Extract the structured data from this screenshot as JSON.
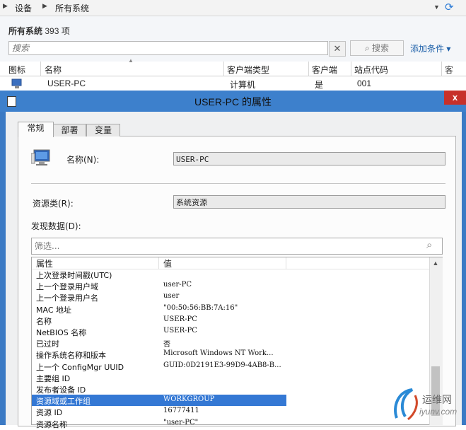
{
  "breadcrumb": {
    "items": [
      "设备",
      "所有系统"
    ]
  },
  "list_header": {
    "title": "所有系统",
    "count": "393",
    "unit": "项"
  },
  "search": {
    "placeholder": "搜索",
    "clear": "✕",
    "button": "搜索",
    "add_criteria": "添加条件 ▾"
  },
  "grid": {
    "columns": [
      "图标",
      "名称",
      "客户端类型",
      "客户端",
      "站点代码"
    ],
    "rows": [
      {
        "name": "USER-PC",
        "client_type": "计算机",
        "client": "是",
        "site_code": "001"
      }
    ]
  },
  "dialog": {
    "title": "USER-PC 的属性",
    "close": "x",
    "tabs": [
      "常规",
      "部署",
      "变量"
    ],
    "name_label": "名称(N):",
    "name_value": "USER-PC",
    "resource_class_label": "资源类(R):",
    "resource_class_value": "系统资源",
    "discovery_label": "发现数据(D):",
    "filter_placeholder": "筛选...",
    "columns": [
      "属性",
      "值"
    ],
    "properties": [
      {
        "name": "上次登录时间戳(UTC)",
        "value": ""
      },
      {
        "name": "上一个登录用户域",
        "value": "user-PC"
      },
      {
        "name": "上一个登录用户名",
        "value": "user"
      },
      {
        "name": "MAC 地址",
        "value": "\"00:50:56:BB:7A:16\""
      },
      {
        "name": "名称",
        "value": "USER-PC"
      },
      {
        "name": "NetBIOS 名称",
        "value": "USER-PC"
      },
      {
        "name": "已过时",
        "value": "否"
      },
      {
        "name": "操作系统名称和版本",
        "value": "Microsoft Windows NT Work..."
      },
      {
        "name": "上一个 ConfigMgr UUID",
        "value": "GUID:0D2191E3-99D9-4AB8-B..."
      },
      {
        "name": "主要组 ID",
        "value": ""
      },
      {
        "name": "发布者设备 ID",
        "value": ""
      },
      {
        "name": "资源域或工作组",
        "value": "WORKGROUP"
      },
      {
        "name": "资源 ID",
        "value": "16777411"
      },
      {
        "name": "资源名称",
        "value": "\"user-PC\""
      }
    ],
    "selected_index": 11
  },
  "watermark": {
    "main": "运维网",
    "sub": "iyunv.com"
  },
  "colors": {
    "title_bar": "#3d80cc",
    "close": "#c7302a",
    "selection": "#3478d4",
    "link": "#1a5ea8"
  }
}
